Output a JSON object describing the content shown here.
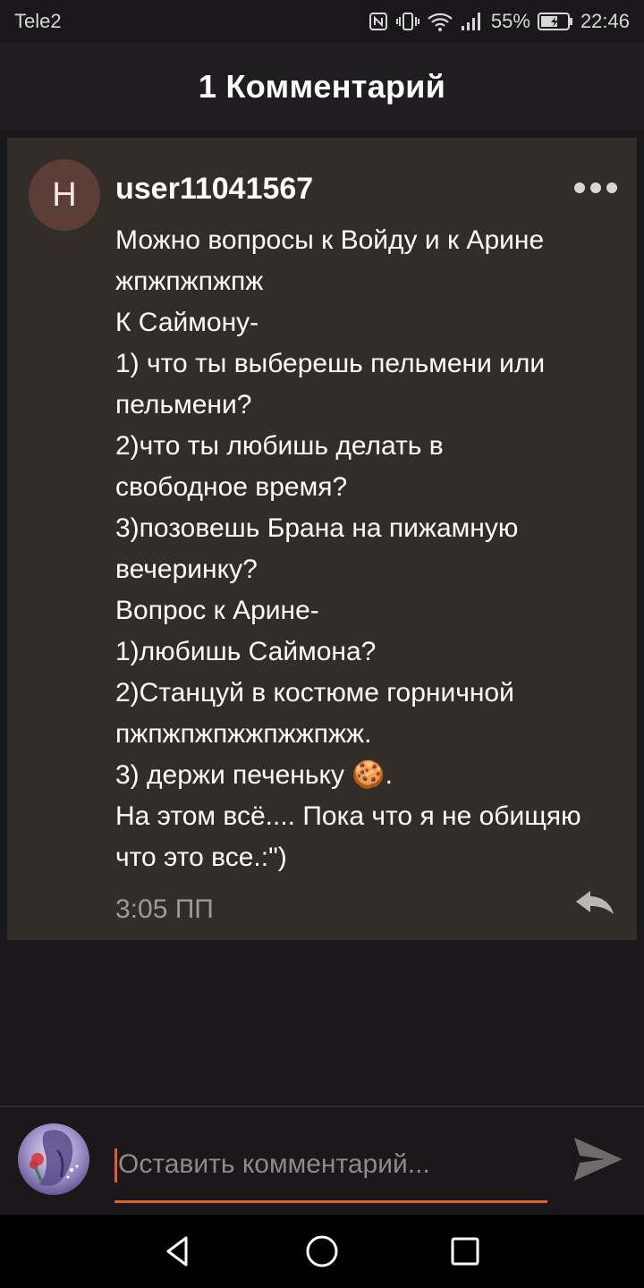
{
  "status_bar": {
    "carrier": "Tele2",
    "battery_percent": "55%",
    "time": "22:46",
    "icons": [
      "nfc-icon",
      "vibrate-icon",
      "wifi-icon",
      "signal-icon",
      "battery-icon"
    ]
  },
  "header": {
    "title": "1 Комментарий"
  },
  "comment": {
    "avatar_letter": "H",
    "username": "user11041567",
    "lines": [
      "Можно вопросы к Войду и к Арине",
      "жпжпжпжпж",
      "К Саймону-",
      "1) что ты выберешь пельмени или",
      "пельмени?",
      "2)что ты любишь делать в",
      "свободное время?",
      "3)позовешь Брана на пижамную",
      "вечеринку?",
      "Вопрос к Арине-",
      "1)любишь Саймона?",
      "2)Станцуй в костюме горничной",
      "пжпжпжпжжпжжпжж.",
      "3) держи печеньку 🍪.",
      "На этом всё.... Пока что я не обищяю",
      "что это все.:\")"
    ],
    "timestamp": "3:05 ПП"
  },
  "compose": {
    "placeholder": "Оставить комментарий...",
    "value": ""
  },
  "colors": {
    "background": "#1a181b",
    "card": "#332d29",
    "accent": "#e25f2a",
    "avatar": "#5c3e36"
  }
}
